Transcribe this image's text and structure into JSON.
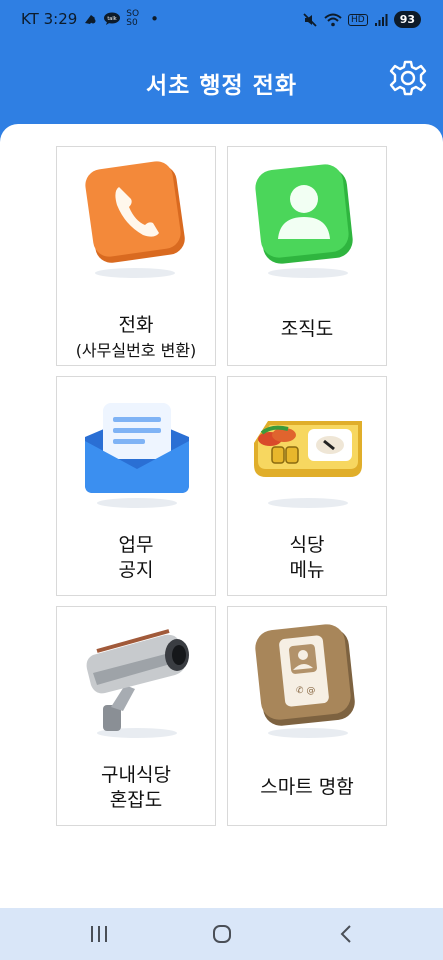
{
  "status_bar": {
    "carrier_time": "KT 3:29",
    "mini_badge_1": "SO",
    "mini_badge_2": "S0",
    "dot": "•",
    "hd": "HD",
    "battery": "93",
    "icons": [
      "gallery-icon",
      "talk-icon",
      "mute-icon",
      "wifi-icon",
      "signal-icon"
    ]
  },
  "app_bar": {
    "title": "서초 행정 전화",
    "settings_icon": "gear-icon"
  },
  "tiles": [
    {
      "id": "phone",
      "label": "전화",
      "sub": "(사무실번호 변환)",
      "icon": "phone-icon",
      "color": "#f3893a"
    },
    {
      "id": "org",
      "label": "조직도",
      "icon": "person-icon",
      "color": "#4bd65a"
    },
    {
      "id": "notice",
      "label_line1": "업무",
      "label_line2": "공지",
      "icon": "envelope-icon",
      "color": "#3b8ff0"
    },
    {
      "id": "menu",
      "label_line1": "식당",
      "label_line2": "메뉴",
      "icon": "lunchbox-icon",
      "color": "#f1c94a"
    },
    {
      "id": "crowd",
      "label_line1": "구내식당",
      "label_line2": "혼잡도",
      "icon": "cctv-camera-icon",
      "color": "#9aa0a6"
    },
    {
      "id": "card",
      "label": "스마트 명함",
      "icon": "contact-card-icon",
      "color": "#a8865a"
    }
  ],
  "nav_bar": {
    "recents": "recents-icon",
    "home": "home-icon",
    "back": "back-icon"
  }
}
